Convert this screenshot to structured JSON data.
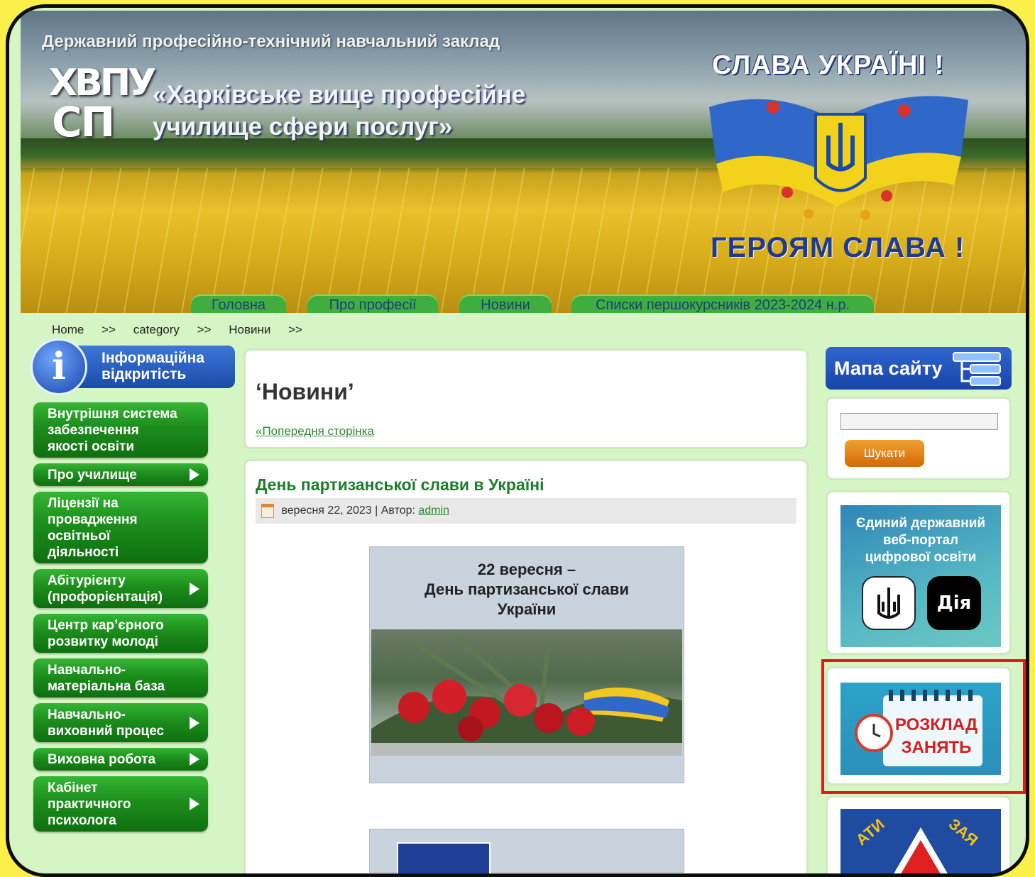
{
  "header": {
    "top_line": "Державний професійно-технічний навчальний заклад",
    "logo_line1": "ХВПУ",
    "logo_line2": "СП",
    "school_name_line1": "«Харківське вище професійне",
    "school_name_line2": "училище сфери послуг»",
    "slogan_top": "СЛАВА УКРАЇНІ !",
    "slogan_bottom": "ГЕРОЯМ СЛАВА !"
  },
  "nav": {
    "tabs": [
      {
        "label": "Головна"
      },
      {
        "label": "Про професії"
      },
      {
        "label": "Новини"
      },
      {
        "label": "Списки першокурсників 2023-2024 н.р."
      }
    ]
  },
  "breadcrumb": {
    "items": [
      "Home",
      ">>",
      "category",
      ">>",
      "Новини",
      ">>"
    ]
  },
  "left_sidebar": {
    "info_badge_line1": "Інформаційна",
    "info_badge_line2": "відкритість",
    "info_icon": "i",
    "menu": [
      {
        "label": "Внутрішня система забезпечення якості освіти",
        "has_submenu": false
      },
      {
        "label": "Про училище",
        "has_submenu": true
      },
      {
        "label": "Ліцензії на провадження освітньої діяльності",
        "has_submenu": false
      },
      {
        "label": "Абітурієнту (профорієнтація)",
        "has_submenu": true
      },
      {
        "label": "Центр кар’єрного розвитку молоді",
        "has_submenu": false
      },
      {
        "label": "Навчально-матеріальна база",
        "has_submenu": false
      },
      {
        "label": "Навчально-виховний процес",
        "has_submenu": true
      },
      {
        "label": "Виховна робота",
        "has_submenu": true
      },
      {
        "label": "Кабінет практичного психолога",
        "has_submenu": true
      }
    ]
  },
  "main": {
    "category_title": "‘Новини’",
    "prev_page_link": "«Попередня сторінка",
    "post": {
      "title": "День партизанської слави в Україні",
      "date": "вересня 22, 2023",
      "author_prefix": "| Автор:",
      "author": "admin",
      "image_caption_line1": "22 вересня –",
      "image_caption_line2": "День партизанської слави",
      "image_caption_line3": "України"
    }
  },
  "right_sidebar": {
    "sitemap_label": "Мапа сайту",
    "search_button": "Шукати",
    "search_value": "",
    "diia_banner_line1": "Єдиний державний",
    "diia_banner_line2": "веб-портал",
    "diia_banner_line3": "цифрової освіти",
    "diia_logo": "Дія",
    "schedule_banner_line1": "РОЗКЛАД",
    "schedule_banner_line2": "ЗАНЯТЬ",
    "bottom_banner_word1": "АТИ",
    "bottom_banner_word2": "ЗАЯ"
  },
  "colors": {
    "page_background": "#d6f5c4",
    "menu_green": "#1c8d1c",
    "nav_tab_green": "#3fae3f",
    "link_green": "#2e8a2e",
    "sitemap_blue": "#1945a8",
    "search_button_orange": "#e07f18",
    "highlight_red": "#e31a1a",
    "outer_yellow": "#fbef4a"
  }
}
